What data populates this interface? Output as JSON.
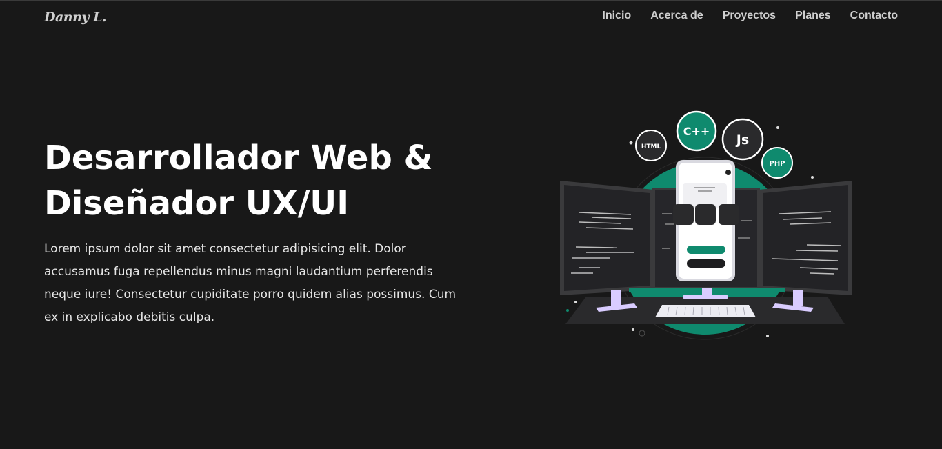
{
  "brand": {
    "logo": "Danny L."
  },
  "nav": {
    "items": [
      "Inicio",
      "Acerca de",
      "Proyectos",
      "Planes",
      "Contacto"
    ]
  },
  "hero": {
    "title_line1": "Desarrollador Web &",
    "title_line2": "Diseñador UX/UI",
    "description": "Lorem ipsum dolor sit amet consectetur adipisicing elit. Dolor accusamus fuga repellendus minus magni laudantium perferendis neque iure! Consectetur cupiditate porro quidem alias possimus. Cum ex in explicabo debitis culpa."
  },
  "illustration": {
    "badges": [
      "HTML",
      "C++",
      "Js",
      "PHP"
    ],
    "accent_color": "#0f8a6e",
    "screen_color": "#232326",
    "stand_color": "#d9ccff"
  }
}
